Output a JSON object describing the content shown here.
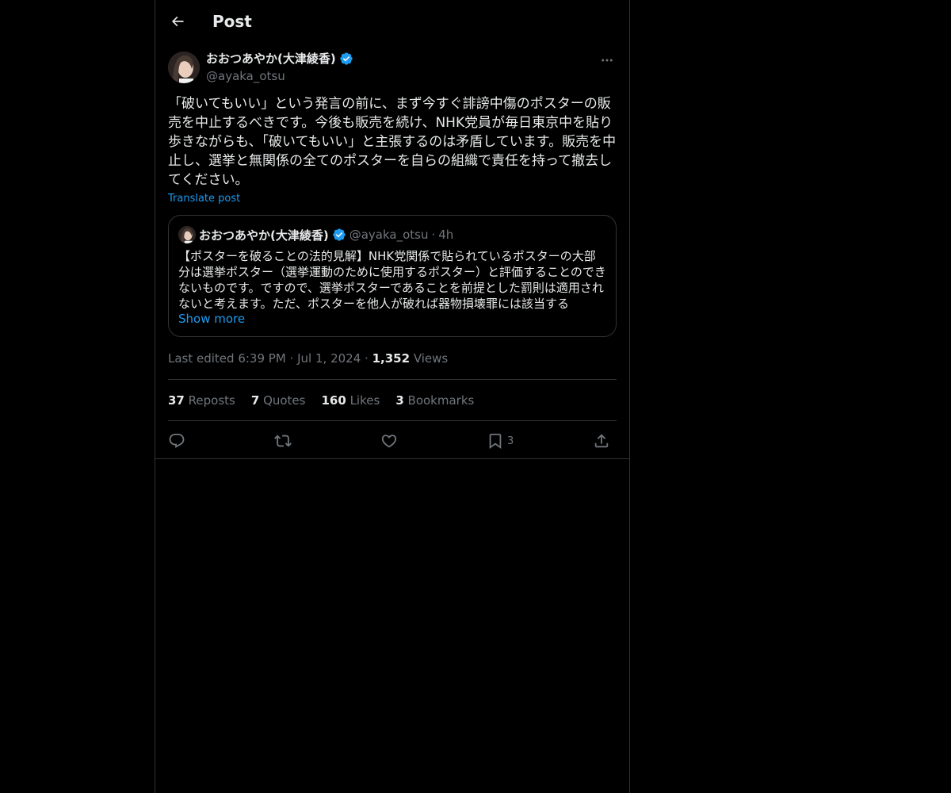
{
  "header": {
    "title": "Post"
  },
  "post": {
    "display_name": "おおつあやか(大津綾香)",
    "handle": "@ayaka_otsu",
    "text": "「破いてもいい」という発言の前に、まず今すぐ誹謗中傷のポスターの販売を中止するべきです。今後も販売を続け、NHK党員が毎日東京中を貼り歩きながらも、「破いてもいい」と主張するのは矛盾しています。販売を中止し、選挙と無関係の全てのポスターを自らの組織で責任を持って撤去してください。",
    "translate_label": "Translate post",
    "quote": {
      "display_name": "おおつあやか(大津綾香)",
      "handle": "@ayaka_otsu",
      "separator": "·",
      "time": "4h",
      "text": "【ポスターを破ることの法的見解】NHK党関係で貼られているポスターの大部分は選挙ポスター（選挙運動のために使用するポスター）と評価することのできないものです。ですので、選挙ポスターであることを前提とした罰則は適用されないと考えます。ただ、ポスターを他人が破れば器物損壊罪には該当する",
      "show_more": "Show more"
    },
    "meta": {
      "edited": "Last edited 6:39 PM",
      "sep1": "·",
      "date": "Jul 1, 2024",
      "sep2": "·",
      "views_count": "1,352",
      "views_label": "Views"
    },
    "stats": {
      "reposts_count": "37",
      "reposts_label": "Reposts",
      "quotes_count": "7",
      "quotes_label": "Quotes",
      "likes_count": "160",
      "likes_label": "Likes",
      "bookmarks_count": "3",
      "bookmarks_label": "Bookmarks"
    },
    "actions": {
      "reply_icon": "reply-icon",
      "repost_icon": "repost-icon",
      "like_icon": "heart-icon",
      "bookmark_icon": "bookmark-icon",
      "bookmark_count": "3",
      "share_icon": "share-icon"
    }
  },
  "colors": {
    "background": "#000000",
    "text": "#e7e9ea",
    "muted": "#71767b",
    "accent": "#1d9bf0",
    "border": "#2f3336"
  }
}
